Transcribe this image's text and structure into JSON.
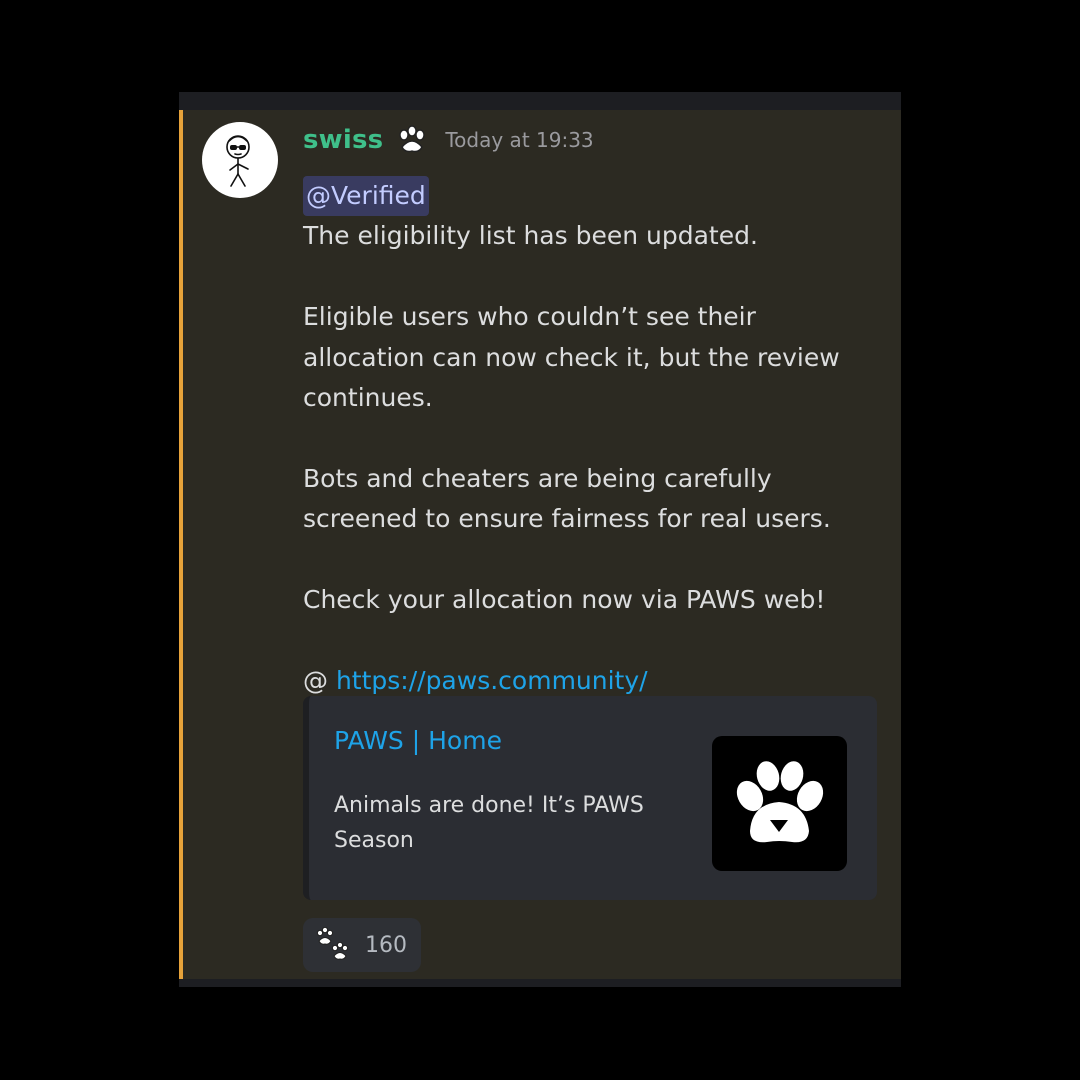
{
  "message": {
    "username": "swiss",
    "timestamp": "Today at 19:33",
    "mention": "@Verified",
    "paragraphs": {
      "p1": "The eligibility list has been updated.",
      "p2": "Eligible users who couldn’t see their allocation can now check it, but the review continues.",
      "p3": "Bots and cheaters are being  carefully screened to ensure fairness for real users.",
      "p4": "Check your allocation now via PAWS web!"
    },
    "link_prefix": "@ ",
    "link_text": "https://paws.community/"
  },
  "embed": {
    "title": "PAWS | Home",
    "description": "Animals are done! It’s PAWS Season",
    "thumbnail_icon": "paw-logo-icon"
  },
  "reaction": {
    "icon": "paw-prints-icon",
    "count": "160"
  },
  "colors": {
    "username": "#3fbf8a",
    "link": "#1ea3e8",
    "highlight_bar": "#e6a23a",
    "message_bg": "#2c2a22"
  }
}
